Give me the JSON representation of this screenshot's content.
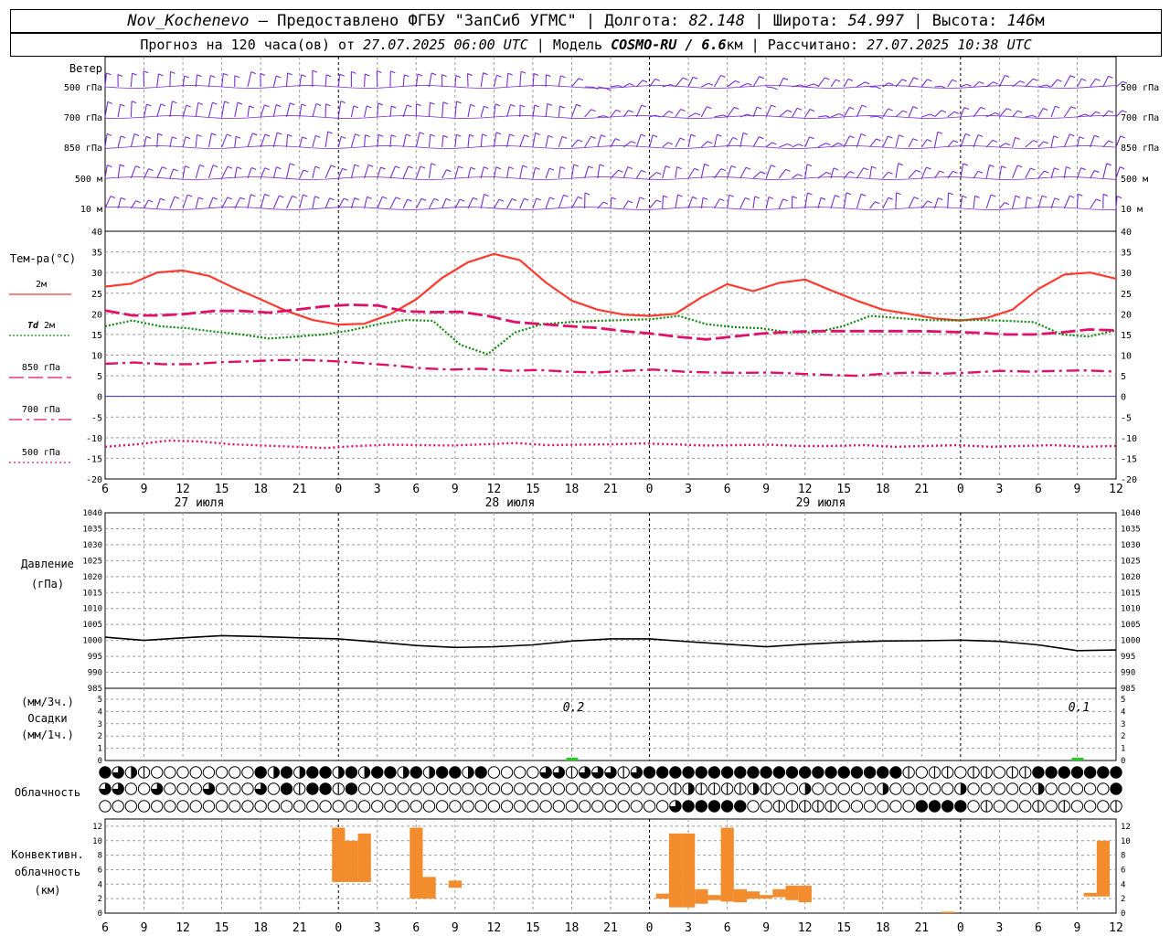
{
  "header": {
    "station": "Nov_Kochenevo",
    "provided_prefix": " – Предоставлено ",
    "provider": "ФГБУ \"ЗапСиб УГМС\"",
    "lon_label": "Долгота:",
    "lon": "82.148",
    "lat_label": "Широта:",
    "lat": "54.997",
    "alt_label": "Высота:",
    "alt": "146",
    "alt_unit": "м",
    "sep": " | ",
    "forecast_prefix": "Прогноз на 120 часа(ов) от ",
    "forecast_time": "27.07.2025 06:00 UTC",
    "model_label": "Модель ",
    "model": "COSMO-RU / 6.6",
    "model_unit": "км",
    "calc_label": "Рассчитано: ",
    "calc_time": "27.07.2025 10:38 UTC"
  },
  "colors": {
    "wind": "#7a2fd0",
    "t2m": "#ff3b30",
    "td2m": "#118a11",
    "level": "#e0106a",
    "pressure": "#000000",
    "precip": "#22cc22",
    "convective": "#f28c2c",
    "zero_line": "#3333dd",
    "grid": "#9a9a9a"
  },
  "labels": {
    "wind": "Ветер",
    "wind_levels": [
      "500 гПа",
      "700 гПа",
      "850 гПа",
      "500 м",
      "10 м"
    ],
    "temp_title": "Тем-ра(°С)",
    "pressure_title": "Давление",
    "pressure_unit": "(гПа)",
    "precip_unit3": "(мм/3ч.)",
    "precip_title": "Осадки",
    "precip_unit1": "(мм/1ч.)",
    "cloud_title": "Облачность",
    "conv_title1": "Конвективн.",
    "conv_title2": "облачность",
    "conv_unit": "(км)"
  },
  "chart_data": {
    "type": "meteogram",
    "time_ticks": [
      "6",
      "9",
      "12",
      "15",
      "18",
      "21",
      "0",
      "3",
      "6",
      "9",
      "12",
      "15",
      "18",
      "21",
      "0",
      "3",
      "6",
      "9",
      "12",
      "15",
      "18",
      "21",
      "0",
      "3",
      "6",
      "9",
      "12"
    ],
    "dates": [
      "27 июля",
      "28 июля",
      "29 июля"
    ],
    "temperature": {
      "ylim": [
        -20,
        40
      ],
      "ticks": [
        40,
        35,
        30,
        25,
        20,
        15,
        10,
        5,
        0,
        -5,
        -10,
        -15,
        -20
      ],
      "series": [
        {
          "name": "2м",
          "style": "solid",
          "values": [
            26.6,
            27.3,
            30,
            30.5,
            29.2,
            26.2,
            23.5,
            20.7,
            18.5,
            17.4,
            17.6,
            19.9,
            23.5,
            28.7,
            32.5,
            34.5,
            33,
            27.6,
            23.2,
            21,
            19.8,
            19.5,
            20,
            24,
            27.2,
            25.5,
            27.5,
            28.3,
            25.7,
            23.2,
            21,
            20,
            18.9,
            18.4,
            19,
            21,
            26,
            29.5,
            30,
            28.5
          ]
        },
        {
          "name": "Td 2м",
          "prefix": "Td",
          "style": "dotted",
          "values": [
            17,
            18.4,
            17,
            16.5,
            15.7,
            15,
            14,
            14.5,
            15,
            16,
            17.5,
            18.5,
            18.3,
            12.5,
            10.2,
            15.5,
            17.5,
            18,
            18.3,
            18.5,
            18.7,
            19.5,
            17.5,
            16.8,
            16.5,
            15.5,
            15.5,
            17,
            19.5,
            19,
            18.5,
            18.4,
            18.5,
            18.3,
            18,
            15,
            14.5,
            16
          ]
        },
        {
          "name": "850 гПа",
          "style": "longdash",
          "values": [
            20.8,
            19.6,
            19.6,
            20,
            20.7,
            20.7,
            20.3,
            21,
            21.8,
            22.2,
            22,
            20.6,
            20.4,
            20.5,
            19.5,
            18,
            17.5,
            17,
            16.6,
            15.8,
            15.2,
            14.4,
            13.8,
            14.5,
            15.2,
            15.6,
            15.8,
            15.8,
            15.8,
            15.8,
            15.8,
            15.6,
            15.4,
            15,
            15,
            15.5,
            16.2,
            16
          ]
        },
        {
          "name": "700 гПа",
          "style": "dashdot",
          "values": [
            7.9,
            8.2,
            7.8,
            7.8,
            8.3,
            8.5,
            8.8,
            8.8,
            8.5,
            8,
            7.5,
            6.8,
            6.5,
            6.7,
            6.2,
            6.4,
            6,
            5.8,
            6.2,
            6.5,
            6,
            5.8,
            5.7,
            5.8,
            5.5,
            5.2,
            5,
            5.5,
            5.8,
            5.5,
            5.8,
            6.2,
            6,
            6.2,
            6.3,
            6
          ]
        },
        {
          "name": "500 гПа",
          "style": "dotted",
          "values": [
            -12.2,
            -11.6,
            -10.7,
            -10.9,
            -11.6,
            -11.9,
            -12.2,
            -12.5,
            -12,
            -11.7,
            -11.8,
            -11.9,
            -11.6,
            -11.3,
            -11.8,
            -11.7,
            -11.6,
            -11.4,
            -11.6,
            -11.9,
            -11.8,
            -11.7,
            -12,
            -12,
            -11.8,
            -12.2,
            -12,
            -11.8,
            -12.2,
            -12,
            -11.8,
            -12.2,
            -12
          ]
        }
      ]
    },
    "pressure": {
      "ylim": [
        985,
        1040
      ],
      "ticks": [
        1040,
        1035,
        1030,
        1025,
        1020,
        1015,
        1010,
        1005,
        1000,
        995,
        990,
        985
      ],
      "values": [
        1001,
        1000,
        1000.8,
        1001.5,
        1001.2,
        1000.8,
        1000.5,
        999.5,
        998.4,
        997.8,
        998,
        998.6,
        999.8,
        1000.5,
        1000.5,
        999.6,
        998.8,
        998,
        998.8,
        999.4,
        999.8,
        999.9,
        1000.1,
        999.7,
        998.6,
        996.8,
        997
      ]
    },
    "precipitation": {
      "ylim": [
        0,
        5
      ],
      "ticks": [
        5,
        4,
        3,
        2,
        1,
        0
      ],
      "events": [
        {
          "t": 36,
          "value": 0.2,
          "label": "0.2"
        },
        {
          "t": 75,
          "value": 0.1,
          "label": "0.1"
        }
      ]
    },
    "cloud_rows": [
      "cloud-row-high",
      "cloud-row-middle",
      "cloud-row-low"
    ],
    "convective_cloud_km": {
      "ylim": [
        0,
        13
      ],
      "ticks": [
        12,
        10,
        8,
        6,
        4,
        2,
        0
      ],
      "bars": [
        {
          "t": 18,
          "base": 4.3,
          "top": 11.8
        },
        {
          "t": 19,
          "base": 4.3,
          "top": 10
        },
        {
          "t": 20,
          "base": 4.3,
          "top": 11
        },
        {
          "t": 24,
          "base": 2,
          "top": 11.8
        },
        {
          "t": 25,
          "base": 2,
          "top": 5
        },
        {
          "t": 27,
          "base": 3.5,
          "top": 4.5
        },
        {
          "t": 43,
          "base": 2,
          "top": 2.7
        },
        {
          "t": 44,
          "base": 0.8,
          "top": 11
        },
        {
          "t": 45,
          "base": 0.8,
          "top": 11
        },
        {
          "t": 46,
          "base": 1.3,
          "top": 3.3
        },
        {
          "t": 47,
          "base": 1.8,
          "top": 2.5
        },
        {
          "t": 48,
          "base": 1.6,
          "top": 11.8
        },
        {
          "t": 49,
          "base": 1.5,
          "top": 3.3
        },
        {
          "t": 50,
          "base": 2,
          "top": 3
        },
        {
          "t": 51,
          "base": 2,
          "top": 2.5
        },
        {
          "t": 52,
          "base": 2.2,
          "top": 3.3
        },
        {
          "t": 53,
          "base": 1.8,
          "top": 3.8
        },
        {
          "t": 54,
          "base": 1.5,
          "top": 3.8
        },
        {
          "t": 65,
          "base": 0,
          "top": 0.2
        },
        {
          "t": 76,
          "base": 2.3,
          "top": 2.8
        },
        {
          "t": 77,
          "base": 2.3,
          "top": 10
        }
      ]
    }
  }
}
